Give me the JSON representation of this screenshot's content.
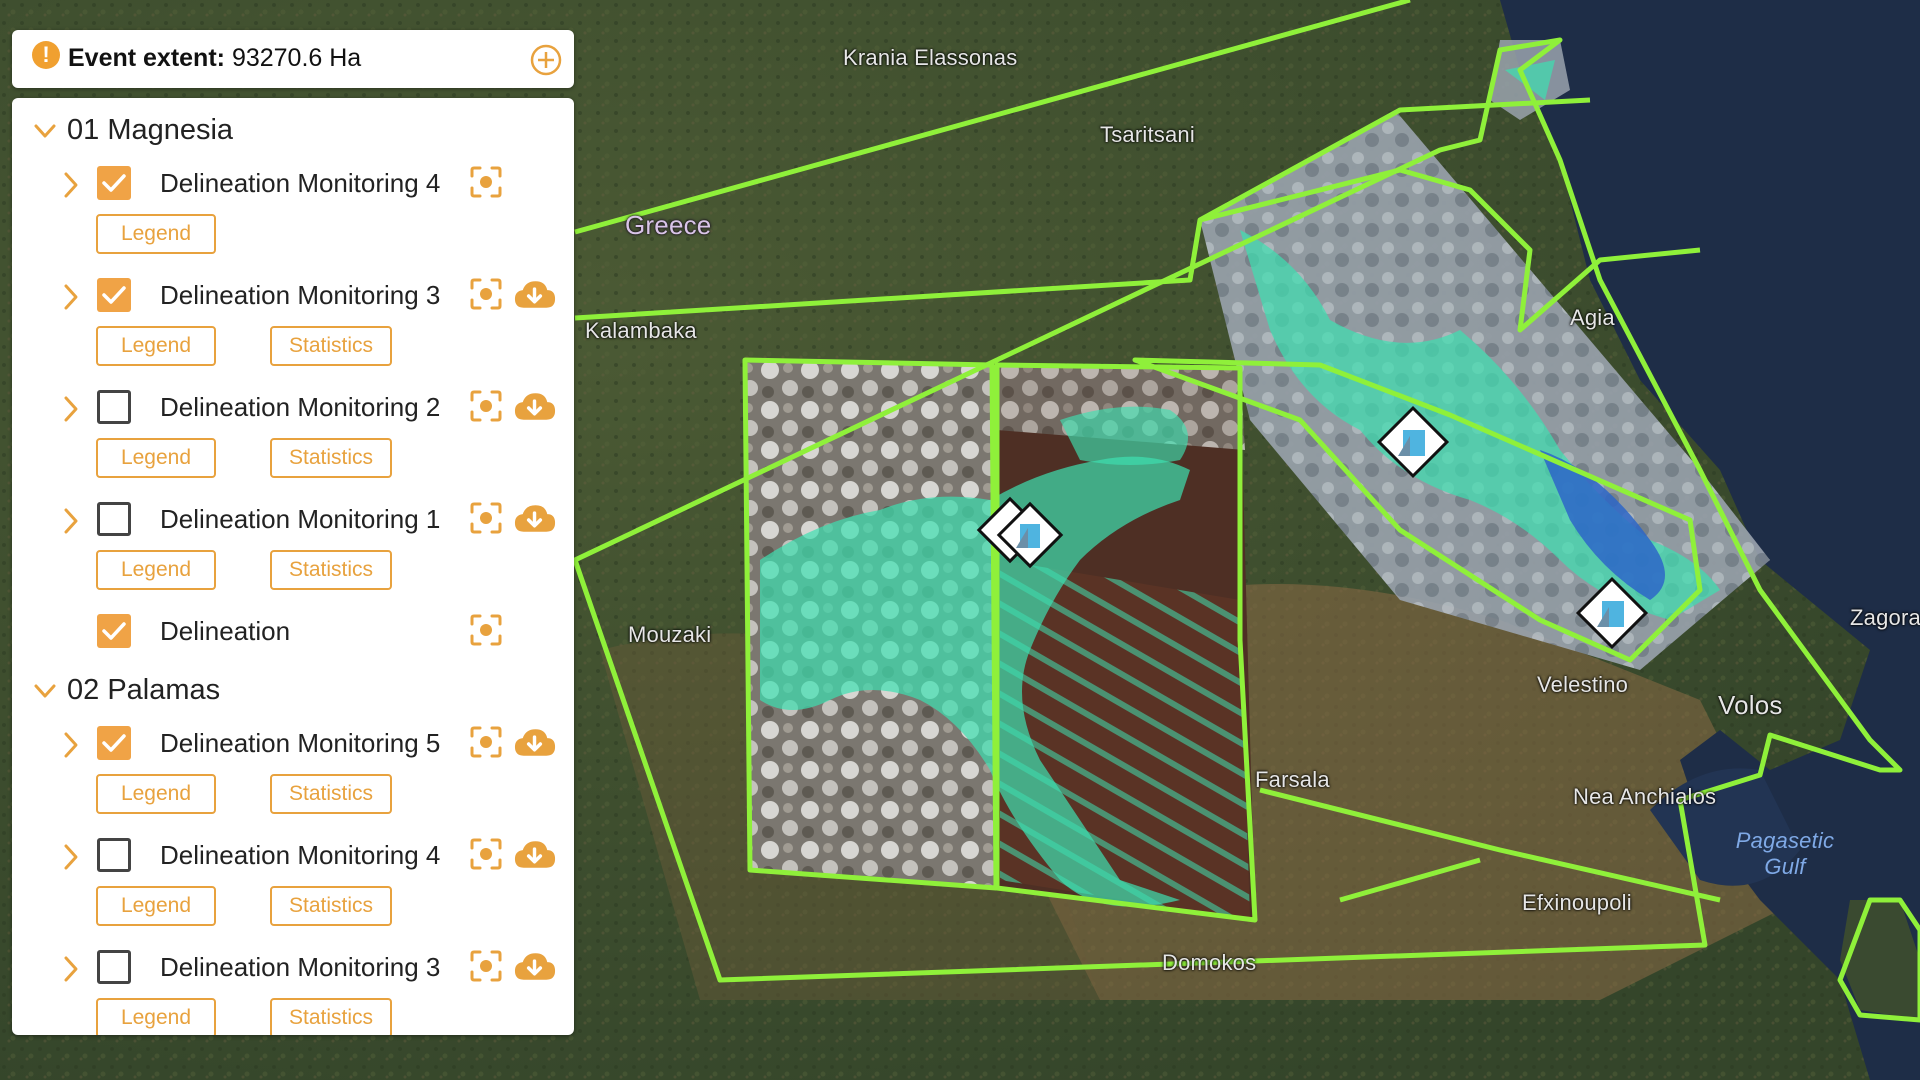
{
  "event": {
    "label": "Event extent:",
    "value": "93270.6 Ha"
  },
  "map": {
    "labels": {
      "krania": "Krania Elassonas",
      "tsaritsani": "Tsaritsani",
      "greece": "Greece",
      "kalambaka": "Kalambaka",
      "agia": "Agia",
      "mouzaki": "Mouzaki",
      "velestino": "Velestino",
      "volos": "Volos",
      "nea": "Nea Anchialos",
      "gulf": "Pagasetic Gulf",
      "farsala": "Farsala",
      "efxinoupoli": "Efxinoupoli",
      "domokos": "Domokos",
      "zagora": "Zagora"
    },
    "colors": {
      "outline": "#8ff03a",
      "flood": "#3de0b0",
      "marker_fill": "#4fb4e0"
    }
  },
  "panel": {
    "groups": [
      {
        "title": "01 Magnesia",
        "layers": [
          {
            "name": "Delineation Monitoring 4",
            "checked": true,
            "legend": "Legend"
          },
          {
            "name": "Delineation Monitoring 3",
            "checked": true,
            "legend": "Legend",
            "stats": "Statistics"
          },
          {
            "name": "Delineation Monitoring 2",
            "checked": false,
            "legend": "Legend",
            "stats": "Statistics"
          },
          {
            "name": "Delineation Monitoring 1",
            "checked": false,
            "legend": "Legend",
            "stats": "Statistics"
          },
          {
            "name": "Delineation",
            "checked": true
          }
        ]
      },
      {
        "title": "02 Palamas",
        "layers": [
          {
            "name": "Delineation Monitoring 5",
            "checked": true,
            "legend": "Legend",
            "stats": "Statistics"
          },
          {
            "name": "Delineation Monitoring 4",
            "checked": false,
            "legend": "Legend",
            "stats": "Statistics"
          },
          {
            "name": "Delineation Monitoring 3",
            "checked": false,
            "legend": "Legend",
            "stats": "Statistics"
          }
        ]
      }
    ]
  },
  "icons": {
    "warning": "exclamation-circle",
    "add": "plus-circle",
    "collapse": "chevron-down",
    "expand": "chevron-right",
    "zoom": "focus-target",
    "download": "cloud-download",
    "marker": "image-diamond"
  }
}
